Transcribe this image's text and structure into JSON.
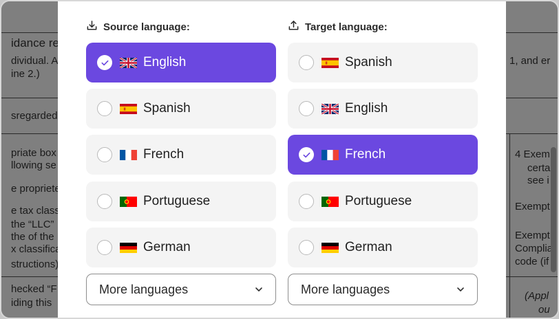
{
  "background_document": {
    "fragments": [
      "idance re",
      "dividual. A",
      "ine 2.)",
      "1, and er",
      "sregarded",
      "priate box",
      "llowing se",
      "e propriete",
      "e tax class",
      "the “LLC”",
      "the of the LLC",
      "x classifica",
      "structions)",
      "hecked “F",
      "iding this",
      "4  Exem",
      "certa",
      "see i",
      "Exempt",
      "Exempt",
      "Complia",
      "code (if",
      "(Appl",
      "ou"
    ]
  },
  "source": {
    "heading": "Source language:",
    "heading_icon": "download-icon",
    "options": [
      {
        "label": "English",
        "flag": "uk-flag",
        "selected": true
      },
      {
        "label": "Spanish",
        "flag": "spain-flag",
        "selected": false
      },
      {
        "label": "French",
        "flag": "france-flag",
        "selected": false
      },
      {
        "label": "Portuguese",
        "flag": "portugal-flag",
        "selected": false
      },
      {
        "label": "German",
        "flag": "germany-flag",
        "selected": false
      }
    ],
    "more_label": "More languages"
  },
  "target": {
    "heading": "Target language:",
    "heading_icon": "upload-icon",
    "options": [
      {
        "label": "Spanish",
        "flag": "spain-flag",
        "selected": false
      },
      {
        "label": "English",
        "flag": "uk-flag",
        "selected": false
      },
      {
        "label": "French",
        "flag": "france-flag",
        "selected": true
      },
      {
        "label": "Portuguese",
        "flag": "portugal-flag",
        "selected": false
      },
      {
        "label": "German",
        "flag": "germany-flag",
        "selected": false
      }
    ],
    "more_label": "More languages"
  },
  "colors": {
    "accent": "#6b48e0",
    "option_bg": "#f4f4f4",
    "overlay": "#7f7f7f"
  }
}
